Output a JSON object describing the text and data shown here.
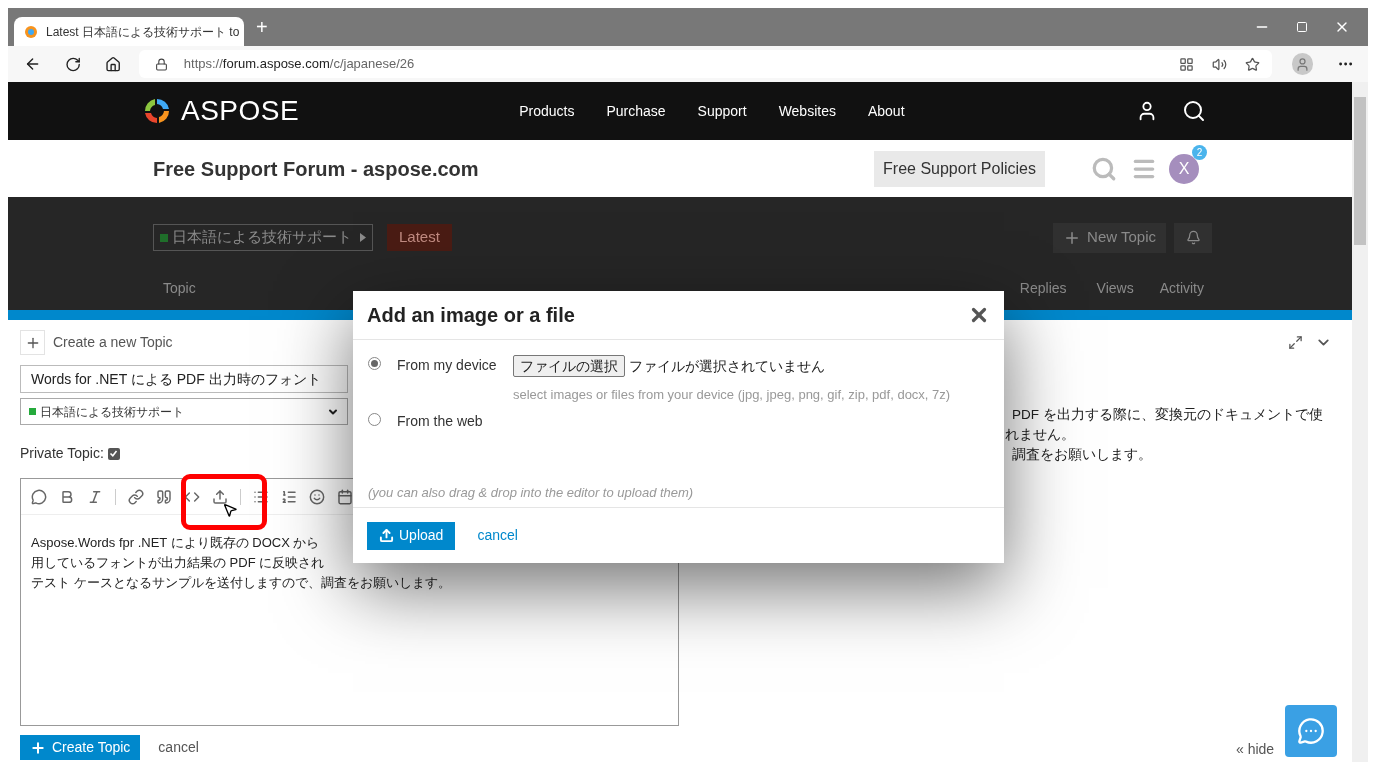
{
  "browser": {
    "tab": {
      "title": "Latest 日本語による技術サポート to",
      "selected": true
    },
    "new_tab": "+",
    "url": {
      "scheme": "https://",
      "domain": "forum.aspose.com",
      "path": "/c/japanese/26"
    }
  },
  "site_nav": {
    "logo": "ASPOSE",
    "items": [
      "Products",
      "Purchase",
      "Support",
      "Websites",
      "About"
    ]
  },
  "forum_header": {
    "title": "Free Support Forum - aspose.com",
    "policies_button": "Free Support Policies",
    "avatar": "X",
    "notification_count": "2"
  },
  "category_bar": {
    "category": "日本語による技術サポート",
    "latest_tab": "Latest",
    "new_topic": "New Topic",
    "columns": [
      "Topic",
      "Replies",
      "Views",
      "Activity"
    ]
  },
  "composer": {
    "action": "Create a new Topic",
    "title_value": "Words for .NET による PDF 出力時のフォント",
    "category": "日本語による技術サポート",
    "private_topic": {
      "label": "Private Topic:",
      "checked": true
    },
    "editor_lines": [
      "Aspose.Words fpr .NET により既存の DOCX から",
      "用しているフォントが出力結果の PDF に反映され",
      "テスト ケースとなるサンプルを送付しますので、調査をお願いします。"
    ],
    "preview_lines": [
      "PDF を出力する際に、変換元のドキュメントで使",
      "れません。",
      "調査をお願いします。"
    ],
    "submit": "Create Topic",
    "cancel": "cancel",
    "hide_preview": "« hide"
  },
  "dialog": {
    "title": "Add an image or a file",
    "options": [
      {
        "label": "From my device",
        "selected": true
      },
      {
        "label": "From the web",
        "selected": false
      }
    ],
    "file_button": "ファイルの選択",
    "file_status": "ファイルが選択されていません",
    "hint": "select images or files from your device (jpg, jpeg, png, gif, zip, pdf, docx, 7z)",
    "drag_note": "(you can also drag & drop into the editor to upload them)",
    "upload": "Upload",
    "cancel": "cancel"
  }
}
